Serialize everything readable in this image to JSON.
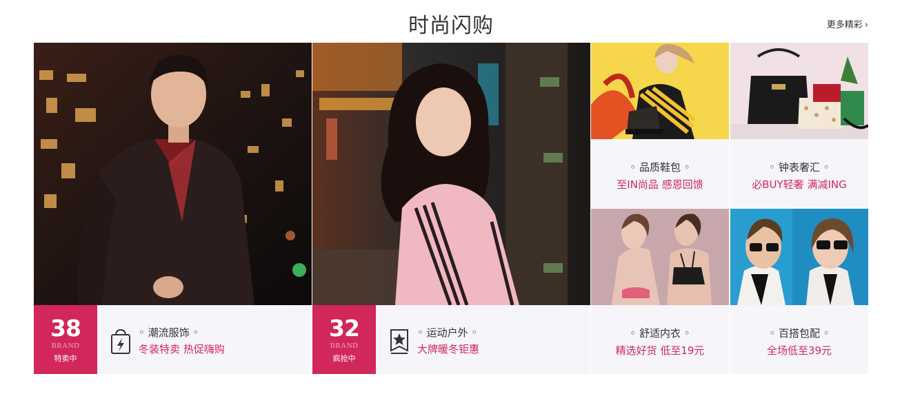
{
  "section": {
    "title": "时尚闪购",
    "more_link": "更多精彩"
  },
  "big_cards": [
    {
      "image_desc": "男士冬装潮流夜景",
      "badge": {
        "count": "38",
        "brand": "BRAND",
        "status": "特卖中"
      },
      "category": "◦ 潮流服饰 ◦",
      "promo": "冬装特卖 热促嗨购",
      "icon": "shopping-bag-lightning-icon"
    },
    {
      "image_desc": "女士运动羽绒服夜景",
      "badge": {
        "count": "32",
        "brand": "BRAND",
        "status": "疯抢中"
      },
      "category": "◦ 运动户外 ◦",
      "promo": "大牌暖冬钜惠",
      "icon": "star-ribbon-icon"
    }
  ],
  "small_cards": [
    {
      "category": "◦ 品质鞋包 ◦",
      "promo": "至IN尚品 感恩回馈"
    },
    {
      "category": "◦ 钟表奢汇 ◦",
      "promo": "必BUY轻奢 满减ING"
    },
    {
      "category": "◦ 舒适内衣 ◦",
      "promo": "精选好货 低至19元"
    },
    {
      "category": "◦ 百搭包配 ◦",
      "promo": "全场低至39元"
    }
  ],
  "colors": {
    "accent": "#d2275b",
    "panel_bg": "#f6f5fa",
    "text": "#333333"
  }
}
